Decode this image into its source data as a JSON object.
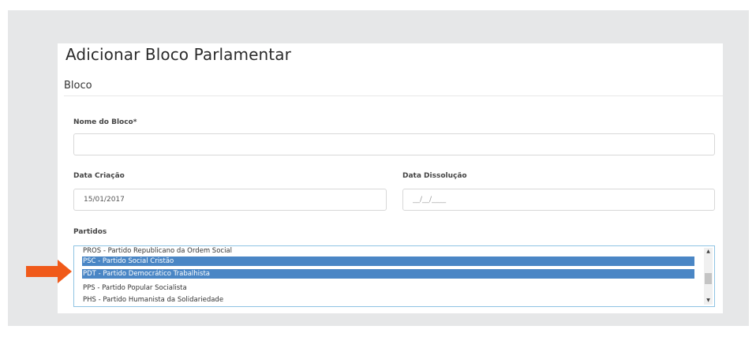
{
  "page": {
    "title": "Adicionar Bloco Parlamentar",
    "section_title": "Bloco"
  },
  "form": {
    "nome_label": "Nome do Bloco*",
    "nome_value": "",
    "data_criacao_label": "Data Criação",
    "data_criacao_value": "15/01/2017",
    "data_dissolucao_label": "Data Dissolução",
    "data_dissolucao_placeholder": "__/__/____",
    "partidos_label": "Partidos"
  },
  "partidos": {
    "options": [
      {
        "label": "PROS - Partido Republicano da Ordem Social",
        "selected": false
      },
      {
        "label": "PSC - Partido Social Cristão",
        "selected": true
      },
      {
        "label": "PDT - Partido Democrático Trabalhista",
        "selected": true
      },
      {
        "label": "PPS - Partido Popular Socialista",
        "selected": false
      },
      {
        "label": "PHS - Partido Humanista da Solidariedade",
        "selected": false
      }
    ],
    "scroll_up_icon": "triangle-up",
    "scroll_down_icon": "triangle-down"
  },
  "colors": {
    "selection": "#4a86c5",
    "arrow": "#f05a1a",
    "listbox_border": "#8fc3e3",
    "panel_background": "#e6e7e8"
  }
}
